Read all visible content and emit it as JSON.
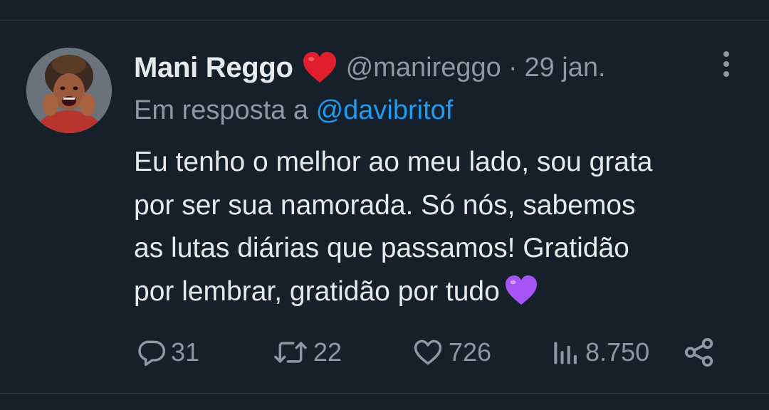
{
  "author": {
    "name": "Mani Reggo",
    "handle": "@manireggo",
    "separator": "·",
    "date": "29 jan."
  },
  "reply": {
    "prefix": "Em resposta a ",
    "mention": "@davibritof"
  },
  "tweet": {
    "text": "Eu tenho o melhor ao meu lado, sou grata\npor ser sua namorada. Só nós, sabemos\nas lutas diárias que passamos! Gratidão\npor lembrar, gratidão por tudo"
  },
  "actions": {
    "replies": "31",
    "retweets": "22",
    "likes": "726",
    "views": "8.750"
  },
  "icons": {
    "name_badge": "red-heart-emoji",
    "text_emoji": "purple-heart-emoji",
    "menu": "more-vertical-icon",
    "reply": "speech-bubble-icon",
    "retweet": "retweet-icon",
    "like": "heart-outline-icon",
    "views": "bar-chart-icon",
    "share": "share-icon"
  },
  "colors": {
    "background": "#15202b",
    "text": "#e7e9ea",
    "muted": "#8b98a5",
    "link": "#1d9bf0",
    "red_heart": "#e01e2d",
    "purple_heart": "#a855f7"
  }
}
